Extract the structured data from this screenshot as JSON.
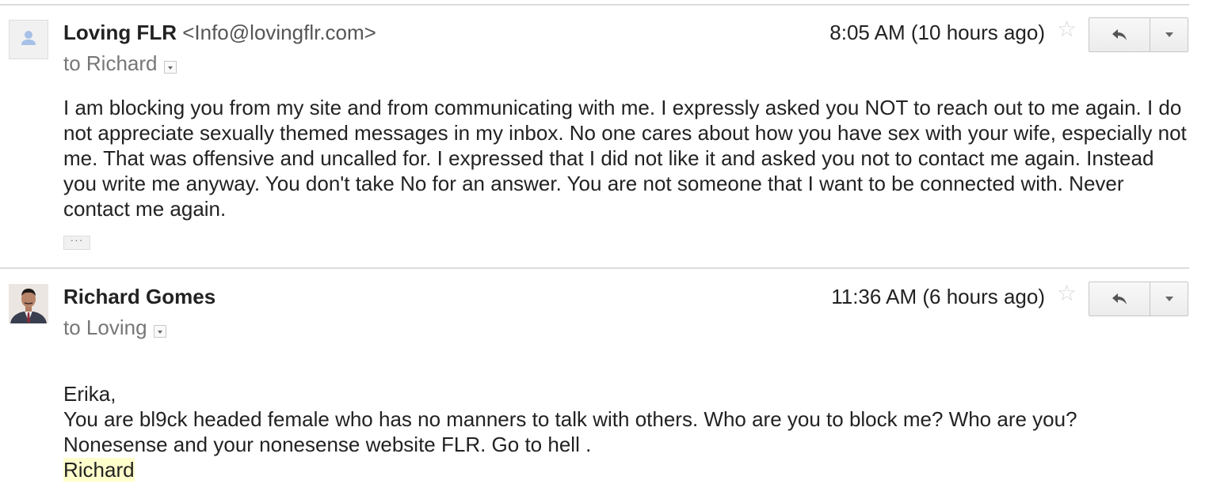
{
  "messages": [
    {
      "sender_name": "Loving FLR",
      "sender_email": "<Info@lovingflr.com>",
      "recipient": "to Richard",
      "timestamp": "8:05 AM (10 hours ago)",
      "avatar_icon": "generic-person-icon",
      "body": "I am blocking you from my site and from communicating with me. I expressly asked you NOT to reach out to me again. I do not appreciate sexually themed messages in my inbox. No one cares about how you have sex with your wife, especially not me. That was offensive and uncalled for. I expressed that I did not like it and asked you not to contact me again. Instead you write me anyway. You don't take No for an answer. You are not someone that I want to be connected with. Never contact me again.",
      "trimmed_content_label": "···"
    },
    {
      "sender_name": "Richard Gomes",
      "recipient": "to Loving",
      "timestamp": "11:36 AM (6 hours ago)",
      "avatar_icon": "profile-photo",
      "body_lines": [
        "Erika,",
        "You are bl9ck headed female who has no manners to talk with others. Who are you to block me? Who are you?",
        "Nonesense and your nonesense website FLR. Go to hell ."
      ],
      "signature": "Richard"
    }
  ],
  "icons": {
    "star": "star-icon",
    "reply": "reply-icon",
    "more": "chevron-down-icon",
    "recipient_details": "caret-down-icon"
  },
  "colors": {
    "divider": "#dcdcdc",
    "signature_highlight": "#ffffcc",
    "muted_text": "#777777"
  }
}
